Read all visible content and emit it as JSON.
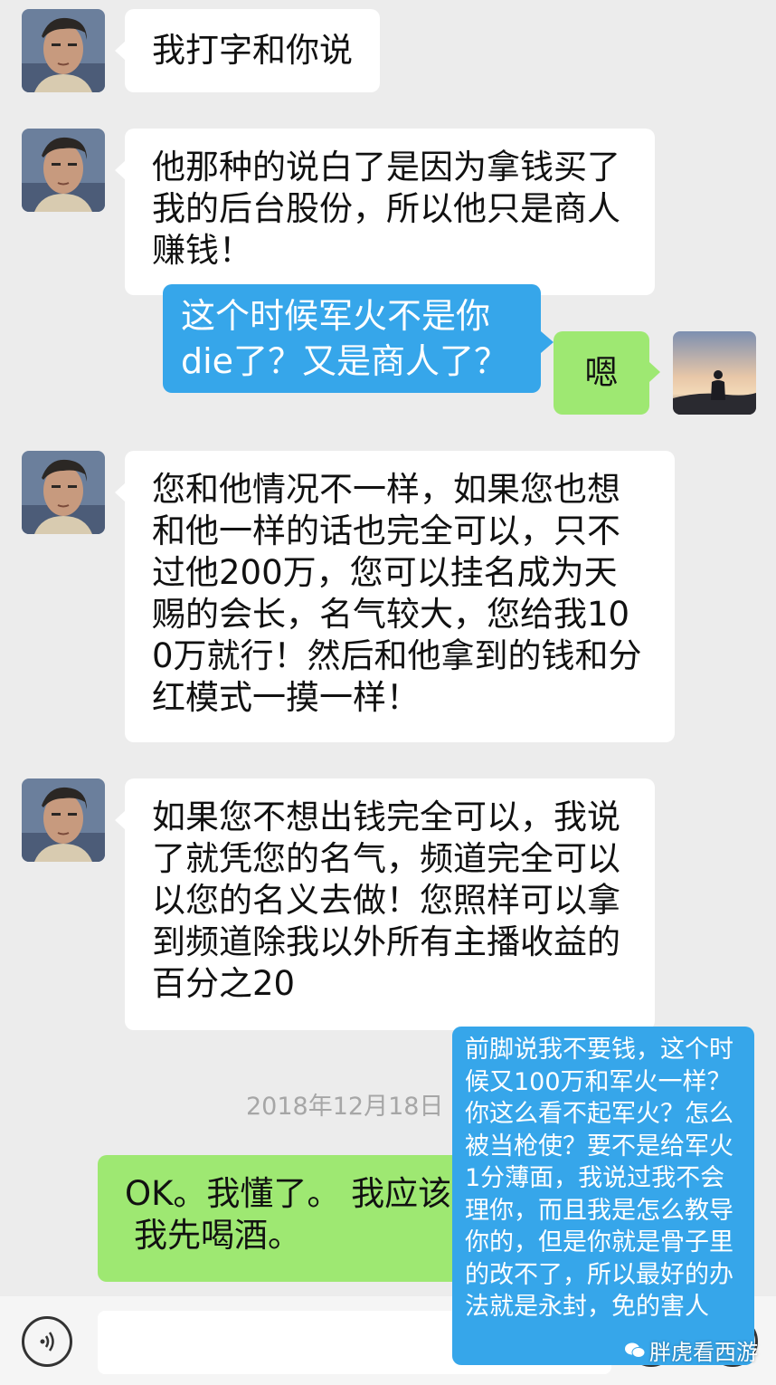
{
  "messages": [
    {
      "id": "m1",
      "text": "我打字和你说"
    },
    {
      "id": "m2",
      "text": "他那种的说白了是因为拿钱买了我的后台股份，所以他只是商人赚钱！"
    },
    {
      "id": "m3",
      "text": "嗯"
    },
    {
      "id": "m4",
      "text": "您和他情况不一样，如果您也想和他一样的话也完全可以，只不过他200万，您可以挂名成为天赐的会长，名气较大，您给我100万就行！然后和他拿到的钱和分红模式一摸一样！"
    },
    {
      "id": "m5",
      "text": "如果您不想出钱完全可以，我说了就凭您的名气，频道完全可以以您的名义去做！您照样可以拿到频道除我以外所有主播收益的百分之20"
    },
    {
      "id": "m6",
      "text": "OK。我懂了。 我应该",
      "line2": "我先喝酒。"
    }
  ],
  "timestamp": "2018年12月18日",
  "annotations": [
    {
      "id": "a1",
      "text": "这个时候军火不是你die了？又是商人了？"
    },
    {
      "id": "a2",
      "text": "前脚说我不要钱，这个时候又100万和军火一样？你这么看不起军火？怎么被当枪使？要不是给军火1分薄面，我说过我不会理你，而且我是怎么教导你的，但是你就是骨子里的改不了，所以最好的办法就是永封，免的害人"
    }
  ],
  "watermark": "胖虎看西游",
  "icons": {
    "voice": "voice-icon",
    "emoji": "emoji-icon",
    "plus": "plus-icon"
  },
  "colors": {
    "background": "#ececec",
    "bubble_incoming": "#ffffff",
    "bubble_outgoing": "#9ee872",
    "annotation": "#36a6ea"
  }
}
